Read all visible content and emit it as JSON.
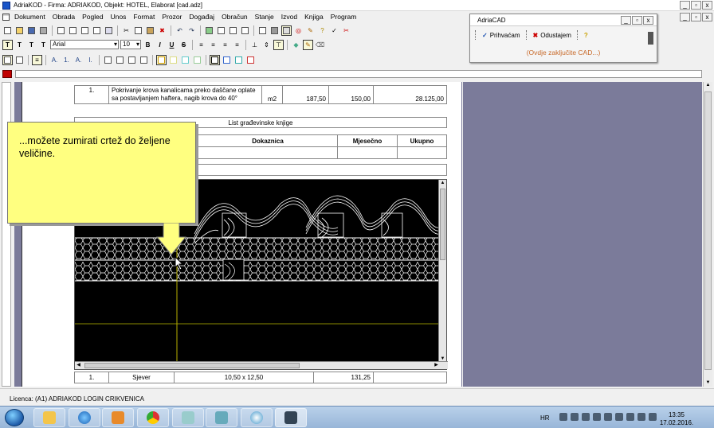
{
  "window": {
    "title": "AdriaKOD - Firma: ADRIAKOD,  Objekt: HOTEL, Elaborat [cad.adz]",
    "btn_min": "_",
    "btn_max": "▫",
    "btn_close": "x"
  },
  "menu": {
    "items": [
      "Dokument",
      "Obrada",
      "Pogled",
      "Unos",
      "Format",
      "Prozor",
      "Događaj",
      "Obračun",
      "Stanje",
      "Izvod",
      "Knjiga",
      "Program"
    ]
  },
  "format_toolbar": {
    "t_labels": [
      "T",
      "T",
      "T",
      "T"
    ],
    "font": "Arial",
    "size": "10",
    "bold": "B",
    "italic": "I",
    "underline": "U",
    "strike": "S"
  },
  "list_toolbar": {
    "labels": [
      "A.",
      "1.",
      "A.",
      "I."
    ]
  },
  "document": {
    "item": {
      "num": "1.",
      "desc": "Pokrivanje krova kanalicama preko daščane oplate sa postavljanjem haftera, nagib krova do 40°",
      "unit": "m2",
      "qty": "187,50",
      "price": "150,00",
      "total": "28.125,00"
    },
    "caption": "List građevinske knjige",
    "headers": [
      "Dokaznica",
      "Mjesečno",
      "Ukupno"
    ],
    "bottom_row": {
      "num": "1.",
      "name": "Sjever",
      "calc": "10,50 x 12,50",
      "val": "131,25"
    }
  },
  "callout": {
    "text": "...možete zumirati crtež do željene veličine."
  },
  "adriacad": {
    "title": "AdriaCAD",
    "accept": "Prihvaćam",
    "cancel": "Odustajem",
    "message": "(Ovdje zaključite CAD...)"
  },
  "status": {
    "licence": "Licenca:  (A1) ADRIAKOD LOGIN CRIKVENICA"
  },
  "taskbar": {
    "lang": "HR",
    "time": "13:35",
    "date": "17.02.2016."
  },
  "colors": {
    "callout": "#ffff80",
    "gray_area": "#7b7b9a",
    "red_marker": "#c00000",
    "cad_background": "#000000",
    "message": "#c86a2a"
  }
}
